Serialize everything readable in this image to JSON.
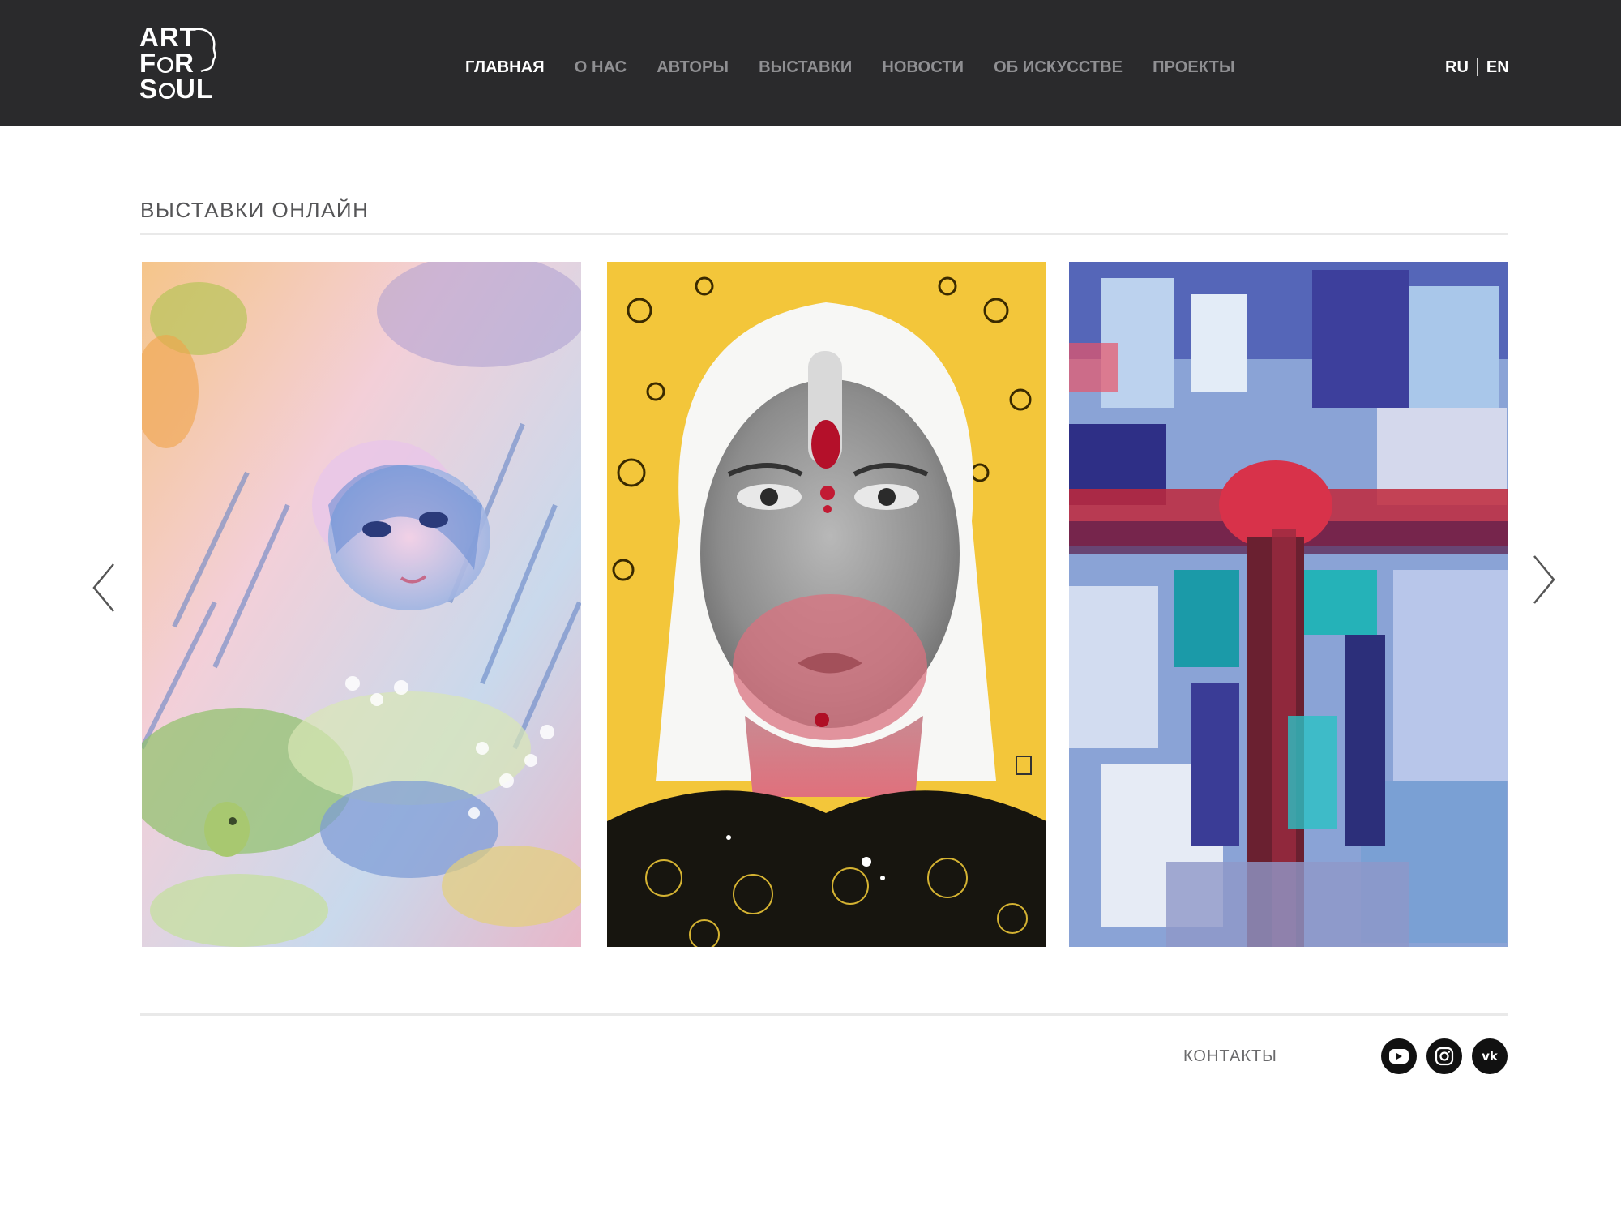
{
  "brand": {
    "logo_lines": [
      "ART",
      "F",
      "R",
      "S",
      "UL"
    ],
    "logo_text": "ART FOR SOUL"
  },
  "nav": {
    "items": [
      {
        "label": "ГЛАВНАЯ",
        "active": true
      },
      {
        "label": "О НАС",
        "active": false
      },
      {
        "label": "АВТОРЫ",
        "active": false
      },
      {
        "label": "ВЫСТАВКИ",
        "active": false
      },
      {
        "label": "НОВОСТИ",
        "active": false
      },
      {
        "label": "ОБ ИСКУССТВЕ",
        "active": false
      },
      {
        "label": "ПРОЕКТЫ",
        "active": false
      }
    ]
  },
  "lang": {
    "ru": "RU",
    "en": "EN",
    "active": "RU"
  },
  "section": {
    "title": "ВЫСТАВКИ ОНЛАЙН"
  },
  "carousel": {
    "slides": [
      {
        "subject": "watercolor girl among leaves with frog and daisies"
      },
      {
        "subject": "portrait of woman with red forehead marks on yellow patterned background"
      },
      {
        "subject": "abstract expressionist crucifix in blue, red and teal"
      }
    ],
    "prev_icon": "chevron-left-icon",
    "next_icon": "chevron-right-icon"
  },
  "footer": {
    "contacts": "КОНТАКТЫ",
    "social": [
      {
        "icon": "youtube-icon"
      },
      {
        "icon": "instagram-icon"
      },
      {
        "icon": "vk-icon",
        "glyph": "vk"
      }
    ]
  },
  "colors": {
    "header_bg": "#2a2a2c",
    "nav_inactive": "#8f8f92",
    "nav_active": "#ffffff",
    "social_bg": "#111111"
  }
}
